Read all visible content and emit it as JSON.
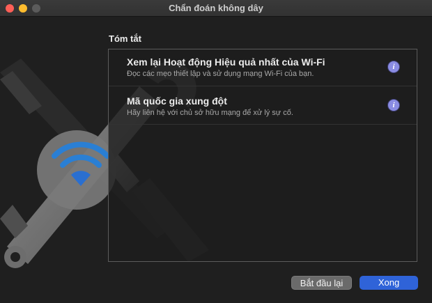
{
  "window": {
    "title": "Chẩn đoán không dây"
  },
  "summary": {
    "heading": "Tóm tắt",
    "items": [
      {
        "title": "Xem lại Hoạt động Hiệu quả nhất của Wi-Fi",
        "description": "Đọc các mẹo thiết lập và sử dụng mạng Wi-Fi của bạn.",
        "icon": "info-icon"
      },
      {
        "title": "Mã quốc gia xung đột",
        "description": "Hãy liên hệ với chủ sở hữu mạng để xử lý sự cố.",
        "icon": "info-icon"
      }
    ]
  },
  "buttons": {
    "restart_label": "Bắt đầu lại",
    "done_label": "Xong"
  },
  "icons": {
    "info_glyph": "i"
  },
  "colors": {
    "accent": "#2f63d8",
    "wifi": "#2a7fd4",
    "info_badge": "#8a8ce3"
  }
}
